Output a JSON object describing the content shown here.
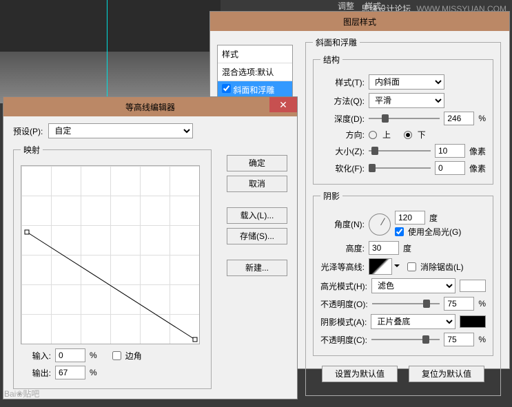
{
  "topTabs": {
    "adjust": "调整",
    "style": "样式"
  },
  "watermark": {
    "site": "思缘设计论坛",
    "url": "WWW.MISSYUAN.COM"
  },
  "layerWin": {
    "title": "图层样式",
    "stylesHeader": "样式",
    "blendDefault": "混合选项:默认",
    "bevelEmboss": "斜面和浮雕",
    "panelTitle": "斜面和浮雕",
    "structGroup": "结构",
    "styleLabel": "样式(T):",
    "styleVal": "内斜面",
    "techLabel": "方法(Q):",
    "techVal": "平滑",
    "depthLabel": "深度(D):",
    "depthVal": "246",
    "pct": "%",
    "dirLabel": "方向:",
    "up": "上",
    "down": "下",
    "sizeLabel": "大小(Z):",
    "sizeVal": "10",
    "px": "像素",
    "softenLabel": "软化(F):",
    "softenVal": "0",
    "shadeGroup": "阴影",
    "angleLabel": "角度(N):",
    "angleVal": "120",
    "deg": "度",
    "globalLight": "使用全局光(G)",
    "altLabel": "高度:",
    "altVal": "30",
    "glossLabel": "光泽等高线:",
    "antialias": "消除锯齿(L)",
    "hlModeLabel": "高光模式(H):",
    "hlModeVal": "滤色",
    "opacityLabel": "不透明度(O):",
    "hlOpVal": "75",
    "shModeLabel": "阴影模式(A):",
    "shModeVal": "正片叠底",
    "shOpLabel": "不透明度(C):",
    "shOpVal": "75",
    "setDefault": "设置为默认值",
    "resetDefault": "复位为默认值"
  },
  "contourWin": {
    "title": "等高线编辑器",
    "presetLabel": "预设(P):",
    "presetVal": "自定",
    "ok": "确定",
    "cancel": "取消",
    "load": "载入(L)...",
    "save": "存储(S)...",
    "new": "新建...",
    "mapGroup": "映射",
    "inputLabel": "输入:",
    "inputVal": "0",
    "outputLabel": "输出:",
    "outputVal": "67",
    "corner": "边角",
    "pct": "%"
  },
  "bottomWatermark": "Bai❀贴吧"
}
